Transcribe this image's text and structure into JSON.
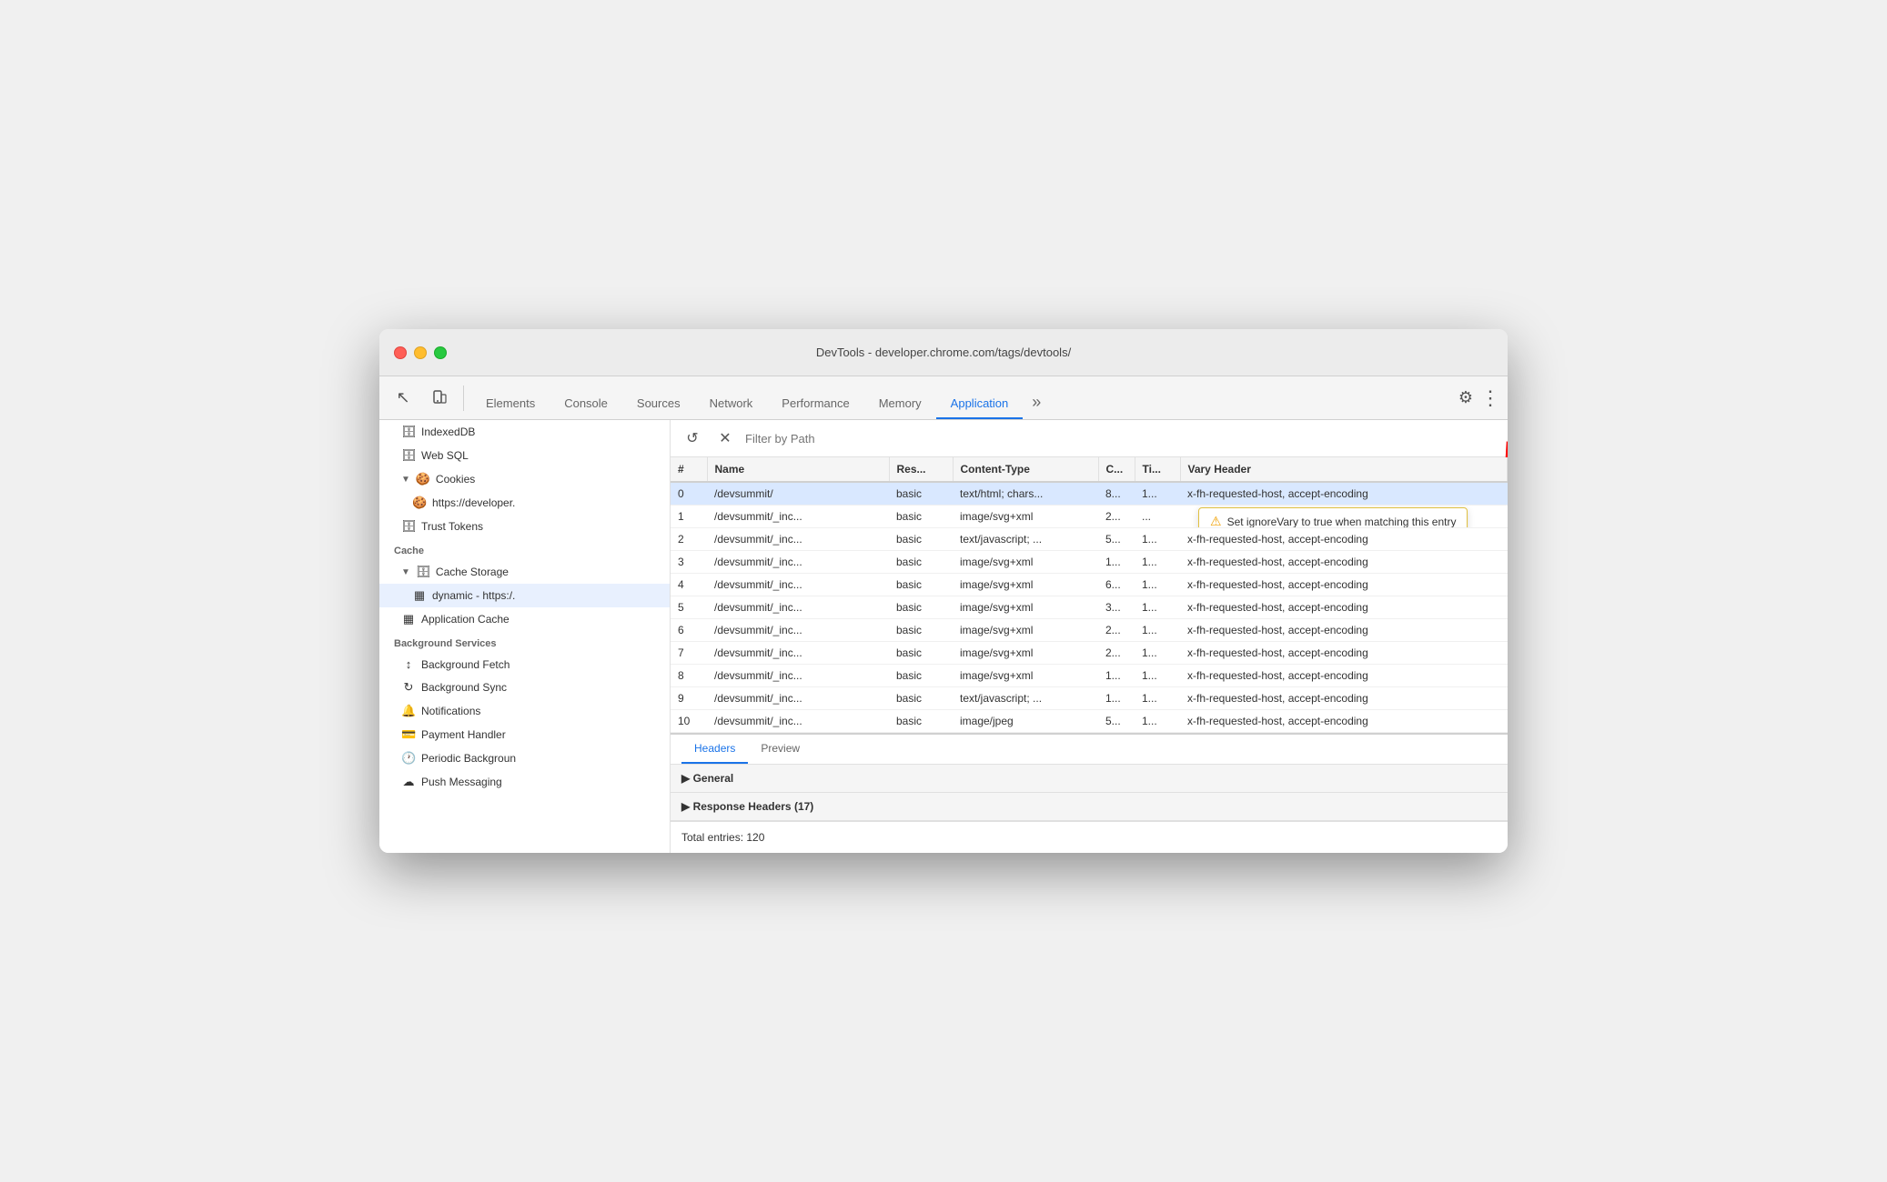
{
  "window": {
    "title": "DevTools - developer.chrome.com/tags/devtools/",
    "tabs": [
      {
        "id": "elements",
        "label": "Elements",
        "active": false
      },
      {
        "id": "console",
        "label": "Console",
        "active": false
      },
      {
        "id": "sources",
        "label": "Sources",
        "active": false
      },
      {
        "id": "network",
        "label": "Network",
        "active": false
      },
      {
        "id": "performance",
        "label": "Performance",
        "active": false
      },
      {
        "id": "memory",
        "label": "Memory",
        "active": false
      },
      {
        "id": "application",
        "label": "Application",
        "active": true
      }
    ]
  },
  "sidebar": {
    "items": [
      {
        "id": "indexeddb",
        "label": "IndexedDB",
        "icon": "🗄",
        "indent": 1
      },
      {
        "id": "websql",
        "label": "Web SQL",
        "icon": "🗄",
        "indent": 1
      },
      {
        "id": "cookies-header",
        "label": "▼ 🍪 Cookies",
        "indent": 1
      },
      {
        "id": "cookies-url",
        "label": "https://developer.",
        "icon": "🍪",
        "indent": 2
      },
      {
        "id": "trust-tokens",
        "label": "Trust Tokens",
        "icon": "🗄",
        "indent": 1
      },
      {
        "id": "cache-section",
        "label": "Cache",
        "section": true
      },
      {
        "id": "cache-storage",
        "label": "▼ 🗄 Cache Storage",
        "indent": 1
      },
      {
        "id": "dynamic",
        "label": "dynamic - https:/.",
        "icon": "▦",
        "indent": 2,
        "selected": true
      },
      {
        "id": "app-cache",
        "label": "Application Cache",
        "icon": "▦",
        "indent": 1
      },
      {
        "id": "bg-section",
        "label": "Background Services",
        "section": true
      },
      {
        "id": "bg-fetch",
        "label": "Background Fetch",
        "icon": "↕",
        "indent": 1
      },
      {
        "id": "bg-sync",
        "label": "Background Sync",
        "icon": "↻",
        "indent": 1
      },
      {
        "id": "notifications",
        "label": "Notifications",
        "icon": "🔔",
        "indent": 1
      },
      {
        "id": "payment",
        "label": "Payment Handler",
        "icon": "💳",
        "indent": 1
      },
      {
        "id": "periodic-bg",
        "label": "Periodic Backgroun",
        "icon": "🕐",
        "indent": 1
      },
      {
        "id": "push-msg",
        "label": "Push Messaging",
        "icon": "☁",
        "indent": 1
      }
    ]
  },
  "filter": {
    "placeholder": "Filter by Path"
  },
  "table": {
    "columns": [
      {
        "id": "num",
        "label": "#"
      },
      {
        "id": "name",
        "label": "Name"
      },
      {
        "id": "res",
        "label": "Res..."
      },
      {
        "id": "ct",
        "label": "Content-Type"
      },
      {
        "id": "c",
        "label": "C..."
      },
      {
        "id": "ti",
        "label": "Ti..."
      },
      {
        "id": "vary",
        "label": "Vary Header"
      }
    ],
    "rows": [
      {
        "num": "0",
        "name": "/devsummit/",
        "res": "basic",
        "ct": "text/html; chars...",
        "c": "8...",
        "ti": "1...",
        "vary": "x-fh-requested-host, accept-encoding",
        "selected": true
      },
      {
        "num": "1",
        "name": "/devsummit/_inc...",
        "res": "basic",
        "ct": "image/svg+xml",
        "c": "2...",
        "ti": "...",
        "vary": "",
        "tooltip": true
      },
      {
        "num": "2",
        "name": "/devsummit/_inc...",
        "res": "basic",
        "ct": "text/javascript; ...",
        "c": "5...",
        "ti": "1...",
        "vary": "x-fh-requested-host, accept-encoding"
      },
      {
        "num": "3",
        "name": "/devsummit/_inc...",
        "res": "basic",
        "ct": "image/svg+xml",
        "c": "1...",
        "ti": "1...",
        "vary": "x-fh-requested-host, accept-encoding"
      },
      {
        "num": "4",
        "name": "/devsummit/_inc...",
        "res": "basic",
        "ct": "image/svg+xml",
        "c": "6...",
        "ti": "1...",
        "vary": "x-fh-requested-host, accept-encoding"
      },
      {
        "num": "5",
        "name": "/devsummit/_inc...",
        "res": "basic",
        "ct": "image/svg+xml",
        "c": "3...",
        "ti": "1...",
        "vary": "x-fh-requested-host, accept-encoding"
      },
      {
        "num": "6",
        "name": "/devsummit/_inc...",
        "res": "basic",
        "ct": "image/svg+xml",
        "c": "2...",
        "ti": "1...",
        "vary": "x-fh-requested-host, accept-encoding"
      },
      {
        "num": "7",
        "name": "/devsummit/_inc...",
        "res": "basic",
        "ct": "image/svg+xml",
        "c": "2...",
        "ti": "1...",
        "vary": "x-fh-requested-host, accept-encoding"
      },
      {
        "num": "8",
        "name": "/devsummit/_inc...",
        "res": "basic",
        "ct": "image/svg+xml",
        "c": "1...",
        "ti": "1...",
        "vary": "x-fh-requested-host, accept-encoding"
      },
      {
        "num": "9",
        "name": "/devsummit/_inc...",
        "res": "basic",
        "ct": "text/javascript; ...",
        "c": "1...",
        "ti": "1...",
        "vary": "x-fh-requested-host, accept-encoding"
      },
      {
        "num": "10",
        "name": "/devsummit/_inc...",
        "res": "basic",
        "ct": "image/jpeg",
        "c": "5...",
        "ti": "1...",
        "vary": "x-fh-requested-host, accept-encoding"
      }
    ],
    "tooltip_text": "Set ignoreVary to true when matching this entry"
  },
  "bottom": {
    "tabs": [
      {
        "id": "headers",
        "label": "Headers",
        "active": true
      },
      {
        "id": "preview",
        "label": "Preview",
        "active": false
      }
    ],
    "sections": [
      {
        "id": "general",
        "label": "▶ General"
      },
      {
        "id": "response-headers",
        "label": "▶ Response Headers (17)"
      }
    ],
    "total_entries": "Total entries: 120"
  },
  "icons": {
    "refresh": "↺",
    "close": "✕",
    "settings": "⚙",
    "more": "⋮",
    "cursor": "↖",
    "device": "📱"
  }
}
